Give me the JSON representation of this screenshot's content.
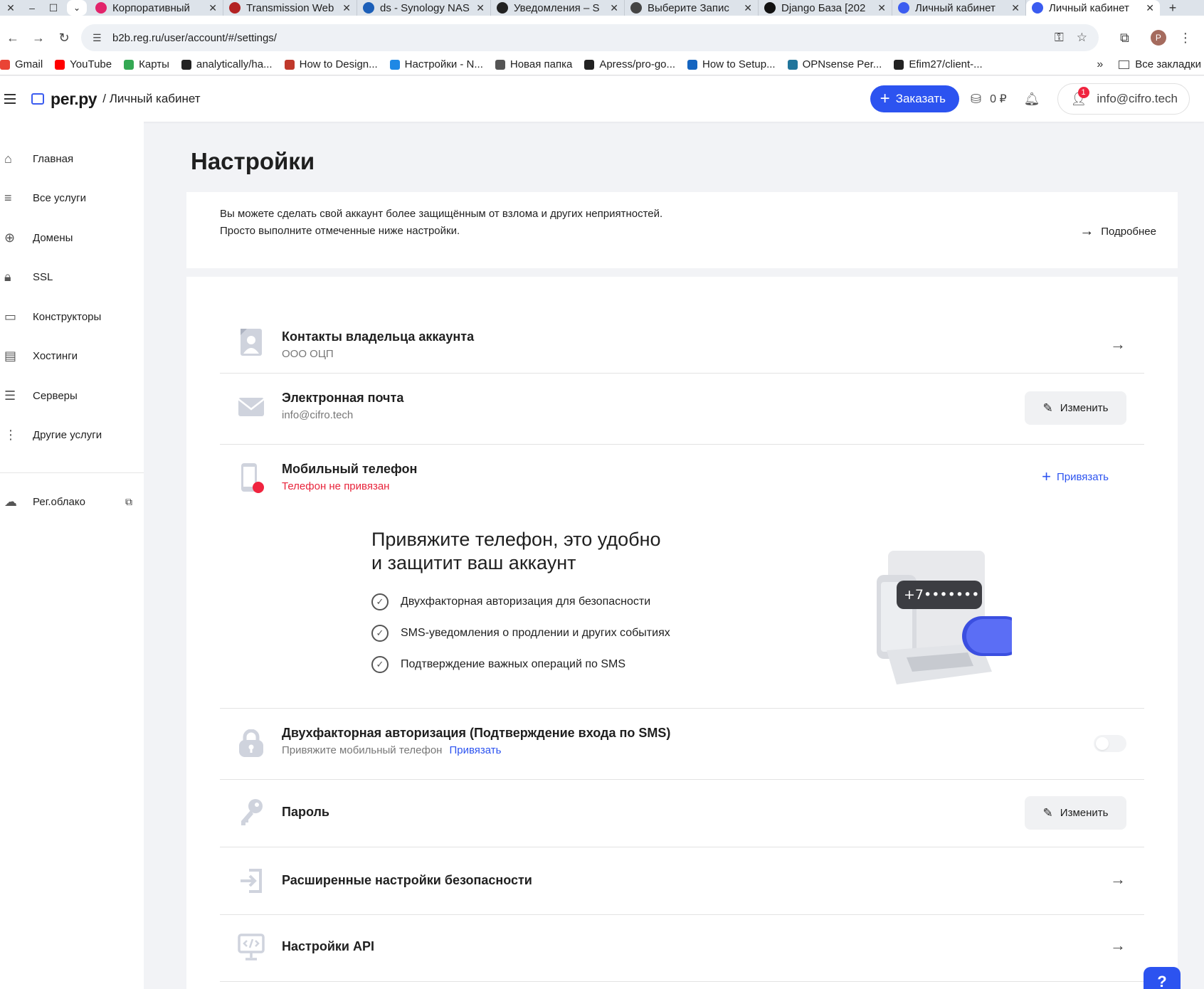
{
  "browser": {
    "tabs": [
      {
        "title": "Корпоративный",
        "color": "#e2246b"
      },
      {
        "title": "Transmission Web",
        "color": "#b32222"
      },
      {
        "title": "ds - Synology NAS",
        "color": "#1c5fb8"
      },
      {
        "title": "Уведомления – S",
        "color": "#222222"
      },
      {
        "title": "Выберите Запис",
        "color": "#444444"
      },
      {
        "title": "Django База [202",
        "color": "#111111"
      },
      {
        "title": "Личный кабинет",
        "color": "#3b5cf0"
      },
      {
        "title": "Личный кабинет",
        "color": "#3b5cf0"
      }
    ],
    "url": "b2b.reg.ru/user/account/#/settings/",
    "profile_initial": "P",
    "bookmarks": [
      {
        "label": "Gmail",
        "color": "#ea4335"
      },
      {
        "label": "YouTube",
        "color": "#ff0000"
      },
      {
        "label": "Карты",
        "color": "#34a853"
      },
      {
        "label": "analytically/ha...",
        "color": "#222222"
      },
      {
        "label": "How to Design...",
        "color": "#c0392b"
      },
      {
        "label": "Настройки - N...",
        "color": "#1e88e5"
      },
      {
        "label": "Новая папка",
        "color": "#555555"
      },
      {
        "label": "Apress/pro-go...",
        "color": "#222222"
      },
      {
        "label": "How to Setup...",
        "color": "#1565c0"
      },
      {
        "label": "OPNsense Per...",
        "color": "#21759b"
      },
      {
        "label": "Efim27/client-...",
        "color": "#222222"
      }
    ],
    "bookmarks_more": "»",
    "all_bookmarks": "Все закладки"
  },
  "header": {
    "logo": "рег.ру",
    "crumb": "/ Личный кабинет",
    "order_label": "Заказать",
    "balance": "0 ₽",
    "notifications_count": "1",
    "account_email": "info@cifro.tech"
  },
  "sidebar": {
    "items": [
      {
        "label": "Главная",
        "icon": "home-icon"
      },
      {
        "label": "Все услуги",
        "icon": "list-icon"
      },
      {
        "label": "Домены",
        "icon": "globe-icon"
      },
      {
        "label": "SSL",
        "icon": "lock-icon"
      },
      {
        "label": "Конструкторы",
        "icon": "window-icon"
      },
      {
        "label": "Хостинги",
        "icon": "hosting-icon"
      },
      {
        "label": "Серверы",
        "icon": "server-icon"
      },
      {
        "label": "Другие услуги",
        "icon": "more-vertical-icon"
      }
    ],
    "cloud_label": "Рег.облако"
  },
  "page": {
    "title": "Настройки",
    "info_line1": "Вы можете сделать свой аккаунт более защищённым от взлома и других неприятностей.",
    "info_line2": "Просто выполните отмеченные ниже настройки.",
    "more_label": "Подробнее"
  },
  "settings": {
    "owner": {
      "title": "Контакты владельца аккаунта",
      "subtitle": "ООО ОЦП"
    },
    "email": {
      "title": "Электронная почта",
      "subtitle": "info@cifro.tech",
      "action": "Изменить"
    },
    "phone": {
      "title": "Мобильный телефон",
      "subtitle": "Телефон не привязан",
      "action": "Привязать"
    },
    "promo": {
      "title_line1": "Привяжите телефон, это удобно",
      "title_line2": "и защитит ваш аккаунт",
      "items": [
        "Двухфакторная авторизация для безопасности",
        "SMS-уведомления о продлении и других событиях",
        "Подтверждение важных операций по SMS"
      ],
      "phone_mask": "+7•••••••"
    },
    "twofa": {
      "title": "Двухфакторная авторизация (Подтверждение входа по SMS)",
      "subtitle": "Привяжите мобильный телефон",
      "link": "Привязать",
      "enabled": false
    },
    "password": {
      "title": "Пароль",
      "action": "Изменить"
    },
    "security": {
      "title": "Расширенные настройки безопасности"
    },
    "api": {
      "title": "Настройки API"
    }
  },
  "help_label": "?",
  "colors": {
    "accent": "#2c53f0",
    "error": "#e8243b"
  }
}
